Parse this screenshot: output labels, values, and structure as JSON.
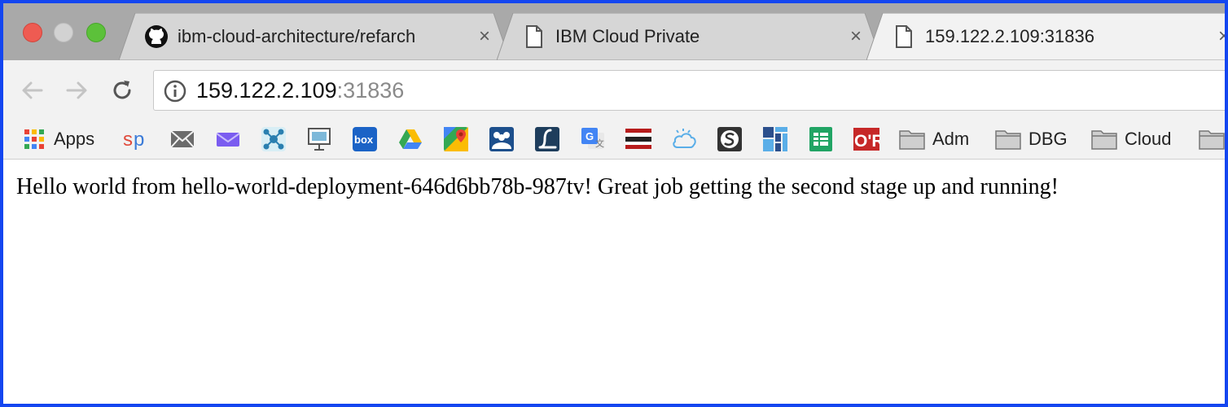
{
  "tabs": [
    {
      "title": "ibm-cloud-architecture/refarch",
      "favicon": "github-icon",
      "active": false
    },
    {
      "title": "IBM Cloud Private",
      "favicon": "document-icon",
      "active": false
    },
    {
      "title": "159.122.2.109:31836",
      "favicon": "document-icon",
      "active": true
    }
  ],
  "tab_close_glyph": "×",
  "address_bar": {
    "host": "159.122.2.109",
    "port": ":31836"
  },
  "bookmarks": {
    "apps_label": "Apps",
    "folders": [
      {
        "label": "Adm"
      },
      {
        "label": "DBG"
      },
      {
        "label": "Cloud"
      }
    ],
    "icons": [
      "sp-icon",
      "mail-icon",
      "envelope-icon",
      "network-icon",
      "monitor-icon",
      "box-icon",
      "google-drive-icon",
      "google-maps-icon",
      "team-icon",
      "l-logo-icon",
      "google-translate-icon",
      "flag-stripes-icon",
      "cloud-icon",
      "s-circle-icon",
      "grid-blocks-icon",
      "sheets-icon",
      "or-logo-icon"
    ]
  },
  "colors": {
    "accent_border": "#1446f0"
  },
  "page": {
    "message": "Hello world from hello-world-deployment-646d6bb78b-987tv! Great job getting the second stage up and running!"
  }
}
